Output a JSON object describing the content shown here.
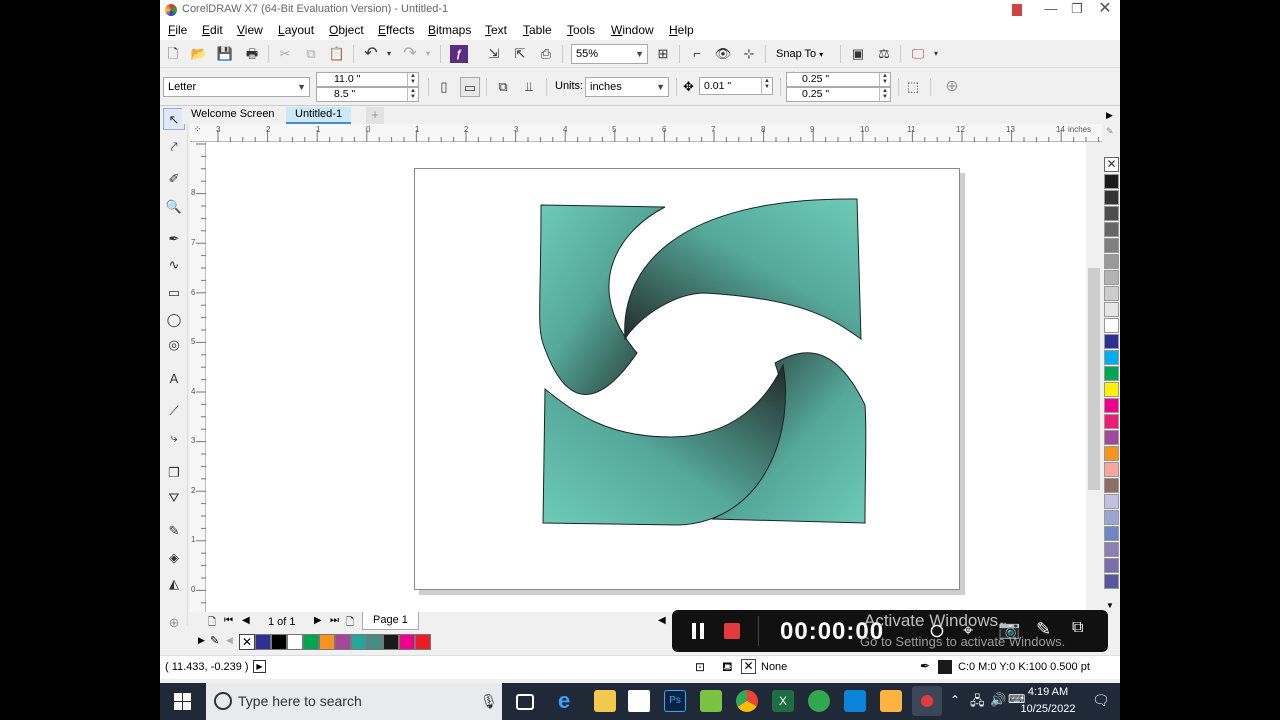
{
  "window": {
    "title": "CorelDRAW X7 (64-Bit Evaluation Version) - Untitled-1"
  },
  "menu": [
    "File",
    "Edit",
    "View",
    "Layout",
    "Object",
    "Effects",
    "Bitmaps",
    "Text",
    "Table",
    "Tools",
    "Window",
    "Help"
  ],
  "standard_toolbar": {
    "zoom": "55%",
    "snap_to": "Snap To"
  },
  "property_bar": {
    "page_size": "Letter",
    "width": "11.0 \"",
    "height": "8.5 \"",
    "units_label": "Units:",
    "units_value": "inches",
    "nudge": "0.01 \"",
    "dup_x": "0.25 \"",
    "dup_y": "0.25 \""
  },
  "document_tabs": [
    "Welcome Screen",
    "Untitled-1"
  ],
  "ruler": {
    "h_ticks": [
      "3",
      "2",
      "1",
      "0",
      "1",
      "2",
      "3",
      "4",
      "5",
      "6",
      "7",
      "8",
      "9",
      "10",
      "11",
      "12",
      "13",
      "14"
    ],
    "h_unit": "inches",
    "v_ticks": [
      "8",
      "7",
      "6",
      "5",
      "4",
      "3",
      "2",
      "1",
      "0"
    ]
  },
  "page_nav": {
    "counter": "1 of 1",
    "page_tab": "Page 1"
  },
  "status": {
    "coords": "( 11.433, -0.239 )",
    "fill": "None",
    "outline": "C:0 M:0 Y:0 K:100  0.500 pt"
  },
  "recorder": {
    "timer": "00:00:00"
  },
  "watermark": {
    "line1": "Activate Windows",
    "line2": "Go to Settings to activate Windows."
  },
  "taskbar": {
    "search_placeholder": "Type here to search",
    "time": "4:19 AM",
    "date": "10/25/2022"
  },
  "colors": {
    "shape_light": "#6ecbb8",
    "shape_dark": "#222c2a",
    "accent": "#cde8f8"
  },
  "palette": [
    "#1a1a1a",
    "#333333",
    "#4d4d4d",
    "#666666",
    "#808080",
    "#999999",
    "#b3b3b3",
    "#cccccc",
    "#e6e6e6",
    "#ffffff",
    "#2e3192",
    "#00aeef",
    "#00a651",
    "#fff200",
    "#ec008c",
    "#ed1c74",
    "#a3479a",
    "#f7941d",
    "#f9a59b",
    "#8c6e63",
    "#c3bfe0",
    "#9aa5d3",
    "#6d86c4",
    "#8b7fb5",
    "#7a6fad",
    "#5a569e"
  ],
  "color_row": [
    "#2e3192",
    "#000000",
    "#ffffff",
    "#00a651",
    "#f7941d",
    "#a3479a",
    "#26a69a",
    "#4a8c84",
    "#1a1a1a",
    "#ec008c",
    "#ed1c24"
  ]
}
